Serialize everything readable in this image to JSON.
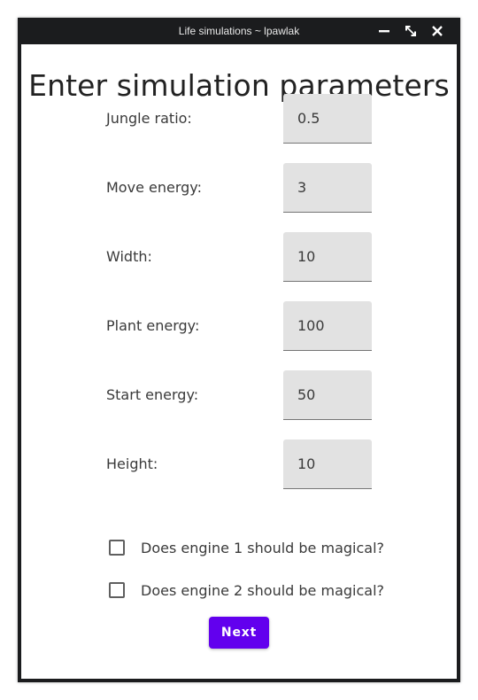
{
  "window": {
    "title": "Life simulations ~ lpawlak",
    "buttons": {
      "minimize": "minimize-icon",
      "maximize": "maximize-icon",
      "close": "close-icon"
    }
  },
  "form": {
    "heading": "Enter simulation parameters",
    "fields": [
      {
        "label": "Jungle ratio:",
        "value": "0.5"
      },
      {
        "label": "Move energy:",
        "value": "3"
      },
      {
        "label": "Width:",
        "value": "10"
      },
      {
        "label": "Plant energy:",
        "value": "100"
      },
      {
        "label": "Start energy:",
        "value": "50"
      },
      {
        "label": "Height:",
        "value": "10"
      }
    ],
    "checkboxes": [
      {
        "label": "Does engine 1 should be magical?",
        "checked": false
      },
      {
        "label": "Does engine 2 should be magical?",
        "checked": false
      }
    ],
    "next_label": "Next"
  },
  "colors": {
    "titlebar": "#1b1c1e",
    "accent": "#6200ee",
    "input_background": "#e2e2e2"
  }
}
